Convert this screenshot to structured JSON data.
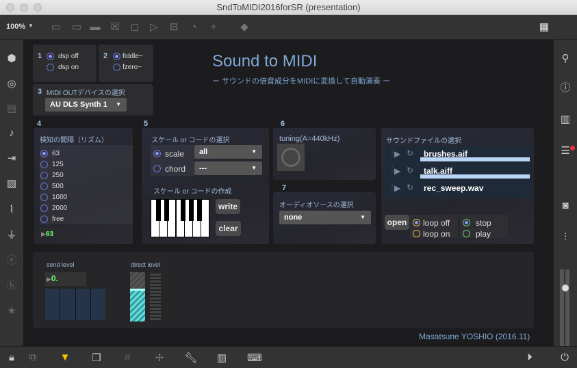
{
  "window": {
    "title": "SndToMIDI2016forSR (presentation)"
  },
  "toolbar": {
    "zoom": "100%"
  },
  "title": "Sound to MIDI",
  "subtitle": "ー サウンドの倍音成分をMIDIに変換して自動演奏 ー",
  "s1": {
    "num": "1",
    "opts": [
      "dsp off",
      "dsp on"
    ]
  },
  "s2": {
    "num": "2",
    "opts": [
      "fiddle~",
      "fzero~"
    ]
  },
  "s3": {
    "num": "3",
    "label": "MIDI OUTデバイスの選択",
    "value": "AU DLS Synth 1"
  },
  "s4": {
    "num": "4",
    "label": "検知の間隔（リズム）",
    "opts": [
      "63",
      "125",
      "250",
      "500",
      "1000",
      "2000",
      "free"
    ],
    "value": "63"
  },
  "s5": {
    "num": "5",
    "label": "スケール or コードの選択",
    "scale": "scale",
    "chord": "chord",
    "scale_value": "all",
    "chord_value": "---",
    "make_label": "スケール or コードの作成",
    "write": "write",
    "clear": "clear"
  },
  "s6": {
    "num": "6",
    "label": "tuning(A=440kHz)"
  },
  "s7": {
    "num": "7",
    "label": "オーディオソースの選択",
    "value": "none"
  },
  "s8": {
    "label": "サウンドファイルの選択",
    "files": [
      "brushes.aif",
      "talk.aiff",
      "rec_sweep.wav"
    ],
    "open": "open",
    "loop": [
      "loop off",
      "loop on"
    ],
    "play": [
      "stop",
      "play"
    ]
  },
  "levels": {
    "send": "send level",
    "direct": "direct level",
    "send_value": "0."
  },
  "credit": "Masatsune YOSHIO (2016.11)"
}
